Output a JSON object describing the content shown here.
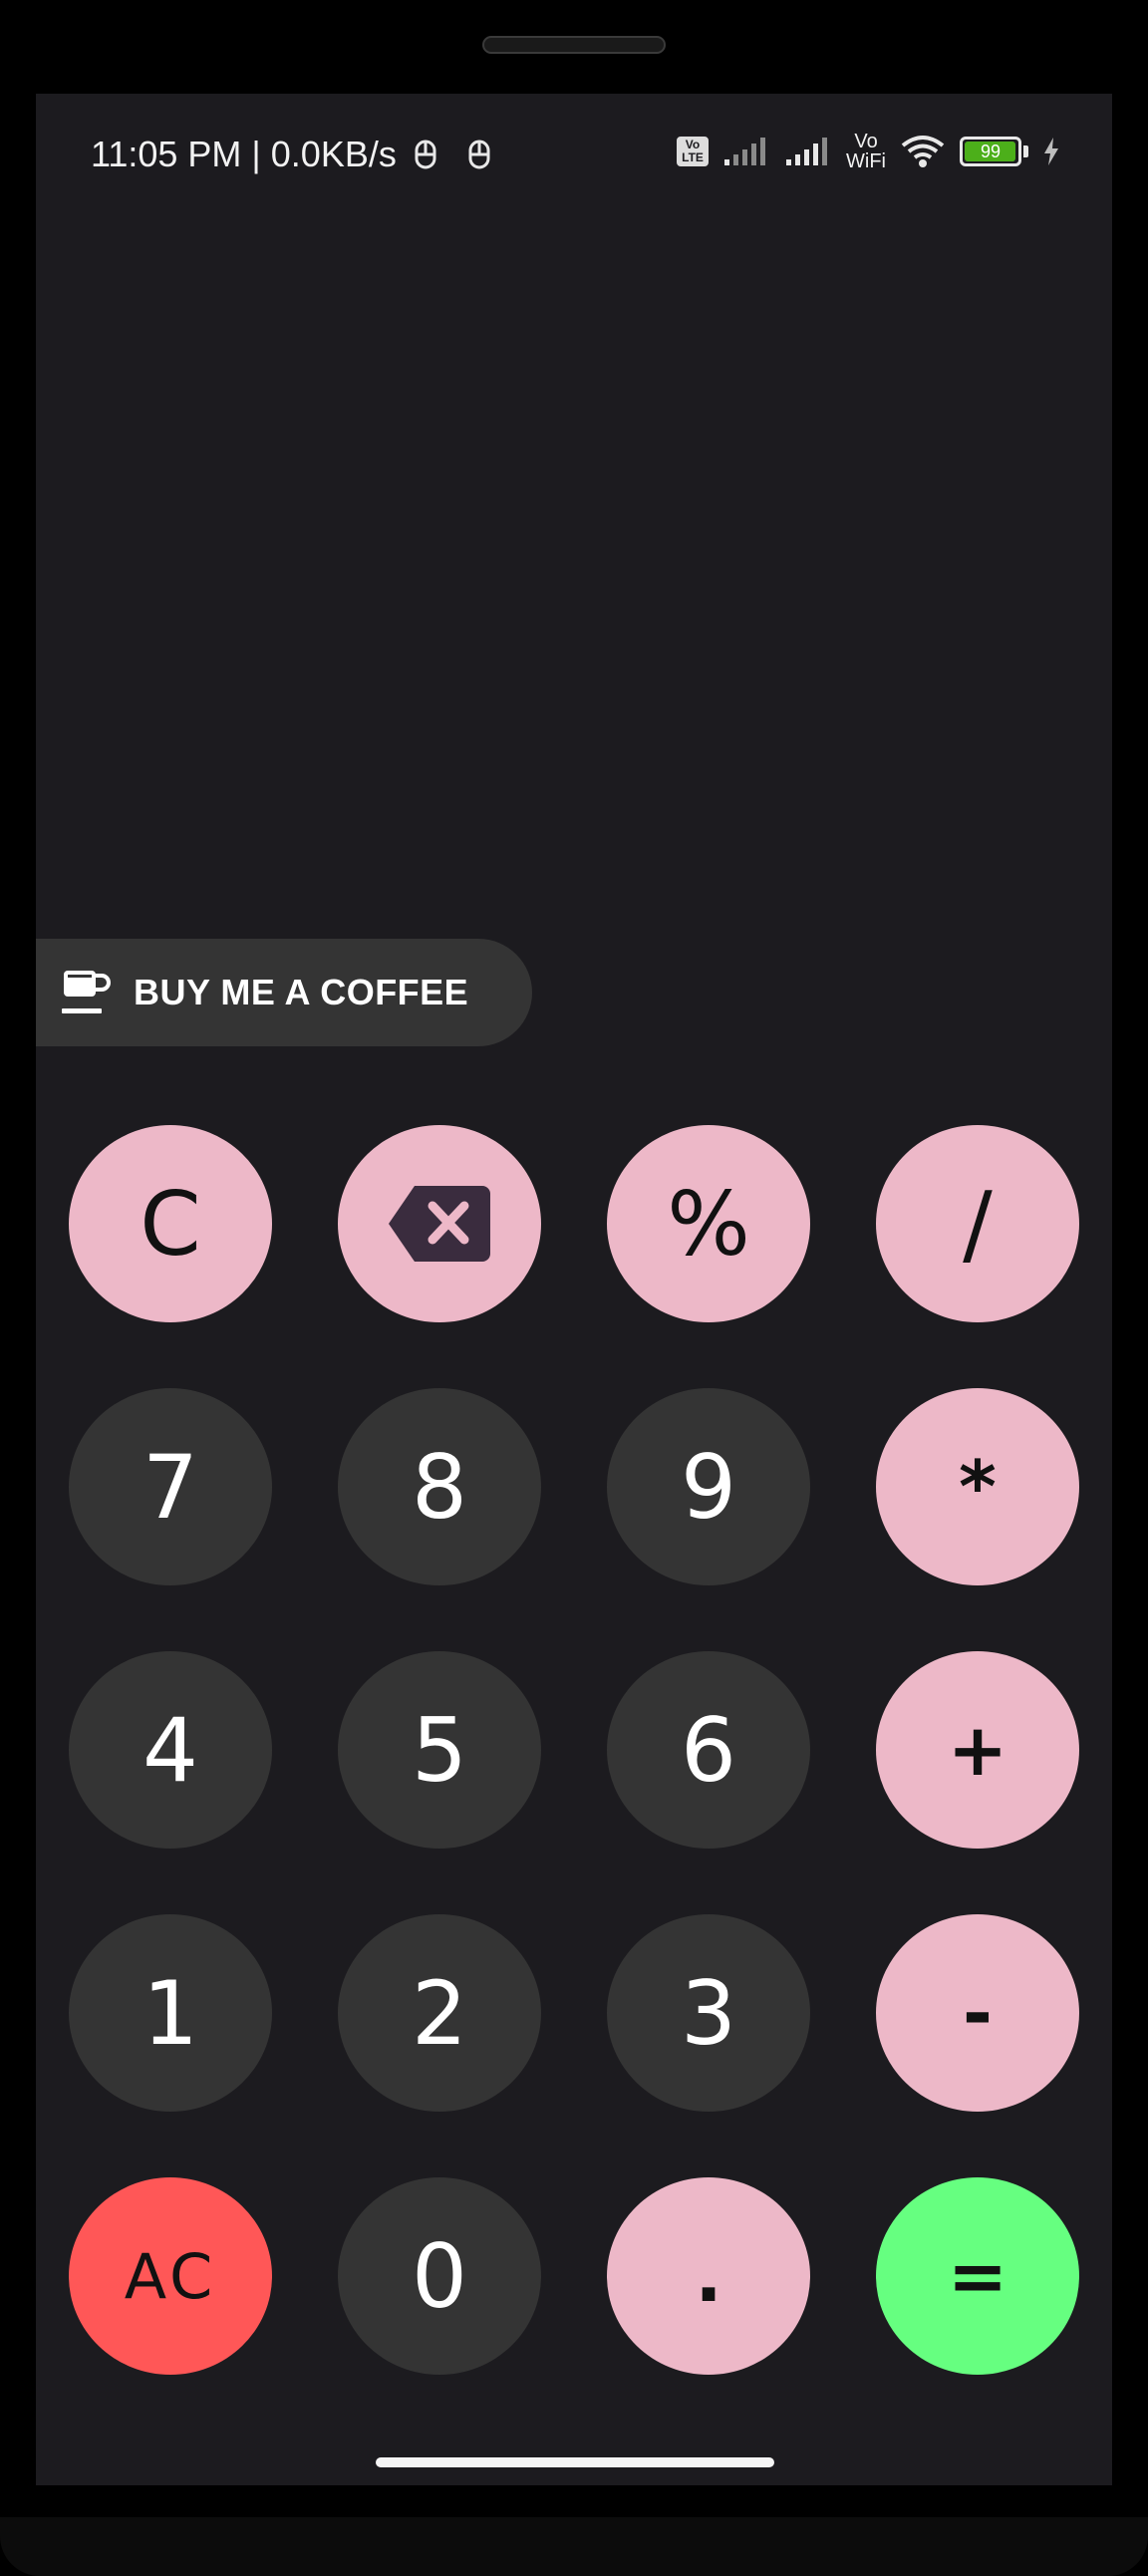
{
  "status_bar": {
    "time": "11:05 PM",
    "separator": "|",
    "network_speed": "0.0KB/s",
    "volte_label": "Vo LTE",
    "vowifi_top": "Vo",
    "vowifi_bottom": "WiFi",
    "battery_level": "99",
    "battery_fraction": 0.99,
    "battery_color": "#4caf1a",
    "icons": [
      "notification-icon",
      "notification-icon",
      "volte-icon",
      "signal-icon",
      "signal-icon",
      "vowifi-icon",
      "wifi-icon",
      "battery-icon",
      "charging-icon"
    ]
  },
  "coffee_button": {
    "icon": "coffee-cup-icon",
    "label": "BUY ME A COFFEE"
  },
  "keypad": {
    "rows": [
      [
        {
          "label": "C",
          "type": "op",
          "name": "clear-button"
        },
        {
          "label": "",
          "type": "op",
          "name": "backspace-button",
          "icon": "backspace-icon"
        },
        {
          "label": "%",
          "type": "op",
          "name": "percent-button"
        },
        {
          "label": "/",
          "type": "op",
          "name": "divide-button"
        }
      ],
      [
        {
          "label": "7",
          "type": "num",
          "name": "digit-7-button"
        },
        {
          "label": "8",
          "type": "num",
          "name": "digit-8-button"
        },
        {
          "label": "9",
          "type": "num",
          "name": "digit-9-button"
        },
        {
          "label": "*",
          "type": "op",
          "name": "multiply-button"
        }
      ],
      [
        {
          "label": "4",
          "type": "num",
          "name": "digit-4-button"
        },
        {
          "label": "5",
          "type": "num",
          "name": "digit-5-button"
        },
        {
          "label": "6",
          "type": "num",
          "name": "digit-6-button"
        },
        {
          "label": "+",
          "type": "op",
          "name": "add-button"
        }
      ],
      [
        {
          "label": "1",
          "type": "num",
          "name": "digit-1-button"
        },
        {
          "label": "2",
          "type": "num",
          "name": "digit-2-button"
        },
        {
          "label": "3",
          "type": "num",
          "name": "digit-3-button"
        },
        {
          "label": "-",
          "type": "op",
          "name": "subtract-button"
        }
      ],
      [
        {
          "label": "AC",
          "type": "ac",
          "name": "all-clear-button"
        },
        {
          "label": "0",
          "type": "num",
          "name": "digit-0-button"
        },
        {
          "label": ".",
          "type": "op",
          "name": "decimal-button"
        },
        {
          "label": "=",
          "type": "eq",
          "name": "equals-button"
        }
      ]
    ]
  },
  "colors": {
    "screen_background": "#1c1b1f",
    "number_key": "#343434",
    "operator_key": "#edb8c8",
    "all_clear_key": "#ff5757",
    "equals_key": "#66ff80",
    "coffee_button": "#343434"
  }
}
